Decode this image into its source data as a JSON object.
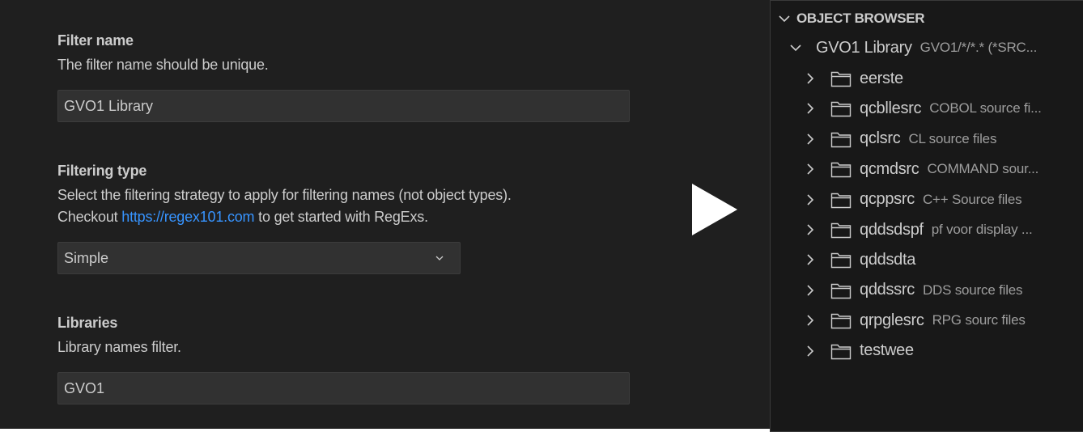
{
  "form": {
    "filter_name": {
      "title": "Filter name",
      "description": "The filter name should be unique.",
      "value": "GVO1 Library"
    },
    "filtering_type": {
      "title": "Filtering type",
      "description_line1": "Select the filtering strategy to apply for filtering names (not object types).",
      "description_prefix": "Checkout",
      "link_text": "https://regex101.com",
      "description_suffix": "to get started with RegExs.",
      "selected": "Simple"
    },
    "libraries": {
      "title": "Libraries",
      "description": "Library names filter.",
      "value": "GVO1"
    }
  },
  "object_browser": {
    "header": "OBJECT BROWSER",
    "filter": {
      "name": "GVO1 Library",
      "description": "GVO1/*/*.* (*SRC..."
    },
    "items": [
      {
        "name": "eerste",
        "description": ""
      },
      {
        "name": "qcbllesrc",
        "description": "COBOL source fi..."
      },
      {
        "name": "qclsrc",
        "description": "CL source files"
      },
      {
        "name": "qcmdsrc",
        "description": "COMMAND sour..."
      },
      {
        "name": "qcppsrc",
        "description": "C++ Source files"
      },
      {
        "name": "qddsdspf",
        "description": "pf voor display ..."
      },
      {
        "name": "qddsdta",
        "description": ""
      },
      {
        "name": "qddssrc",
        "description": "DDS source files"
      },
      {
        "name": "qrpglesrc",
        "description": "RPG sourc files"
      },
      {
        "name": "testwee",
        "description": ""
      }
    ]
  },
  "icons": {
    "collapse": "chevron-down-icon",
    "expand": "chevron-right-icon",
    "folder": "folder-icon",
    "transition": "play-arrow-icon"
  },
  "colors": {
    "form_background": "#1f1f1f",
    "tree_background": "#181818",
    "input_background": "#313131",
    "link": "#3794ff",
    "text": "#cccccc",
    "muted_text": "#9d9d9d"
  }
}
